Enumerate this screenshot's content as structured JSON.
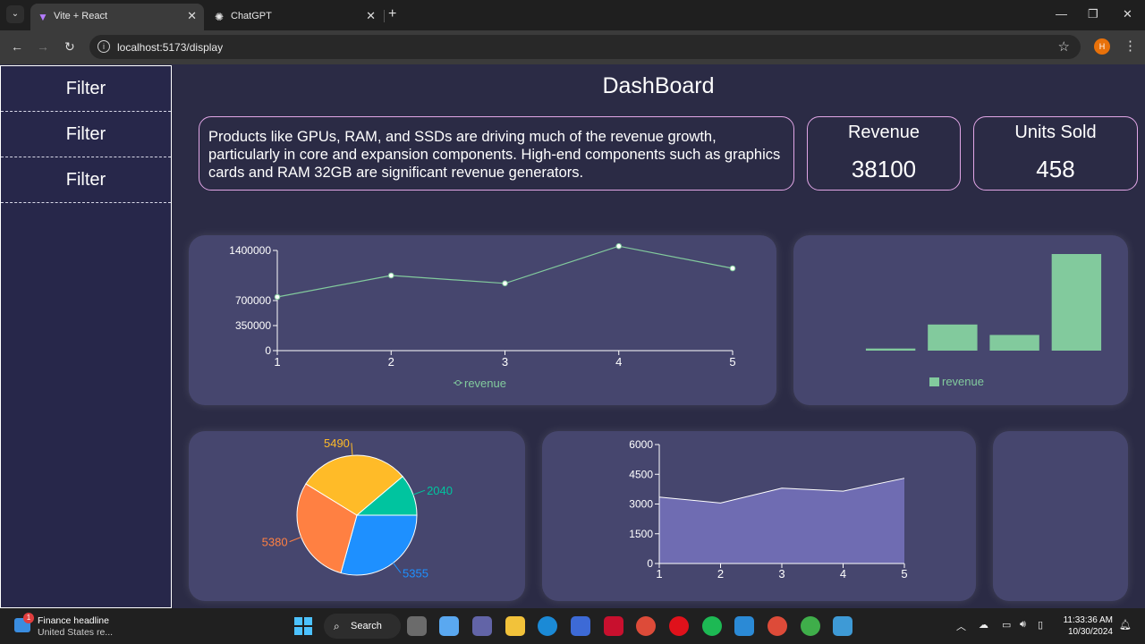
{
  "browser": {
    "tabs": [
      {
        "title": "Vite + React",
        "icon": "vite-icon",
        "active": true
      },
      {
        "title": "ChatGPT",
        "icon": "chatgpt-icon",
        "active": false
      }
    ],
    "url": "localhost:5173/display",
    "profile_initial": "H"
  },
  "sidebar": {
    "items": [
      {
        "label": "Filter"
      },
      {
        "label": "Filter"
      },
      {
        "label": "Filter"
      }
    ]
  },
  "dashboard": {
    "title": "DashBoard",
    "insight": "Products like GPUs, RAM, and SSDs are driving much of the revenue growth, particularly in core and expansion components. High-end components such as graphics cards and RAM 32GB are significant revenue generators.",
    "stats": [
      {
        "label": "Revenue",
        "value": "38100"
      },
      {
        "label": "Units Sold",
        "value": "458"
      }
    ]
  },
  "colors": {
    "page_bg": "#2b2b45",
    "card_bg": "#46466e",
    "line_green": "#82ca9d",
    "area_purple": "#6f6cb2",
    "card_border": "#e1a6e6",
    "pie": [
      "#1e90ff",
      "#ff8042",
      "#ffbb28",
      "#00c49f"
    ]
  },
  "chart_data": [
    {
      "type": "line",
      "x": [
        1,
        2,
        3,
        4,
        5
      ],
      "series": [
        {
          "name": "revenue",
          "values": [
            750000,
            1050000,
            940000,
            1460000,
            1150000
          ]
        }
      ],
      "yticks": [
        "0",
        "350000",
        "700000",
        "1400000"
      ],
      "ylim": [
        0,
        1400000
      ],
      "legend": "bottom",
      "grid": false
    },
    {
      "type": "bar",
      "categories": [
        "1",
        "2",
        "3",
        "4"
      ],
      "series": [
        {
          "name": "revenue",
          "values": [
            40000,
            500000,
            300000,
            1850000
          ]
        }
      ],
      "ylim": [
        0,
        1850000
      ],
      "axes_visible": false,
      "legend": "bottom"
    },
    {
      "type": "pie",
      "slices": [
        {
          "value": 5355,
          "color": "#1e90ff"
        },
        {
          "value": 5380,
          "color": "#ff8042"
        },
        {
          "value": 5490,
          "color": "#ffbb28"
        },
        {
          "value": 2040,
          "color": "#00c49f"
        }
      ],
      "labels": [
        "5355",
        "5380",
        "5490",
        "2040"
      ]
    },
    {
      "type": "area",
      "x": [
        1,
        2,
        3,
        4,
        5
      ],
      "series": [
        {
          "values": [
            3350,
            3050,
            3800,
            3650,
            4300
          ]
        }
      ],
      "yticks": [
        "0",
        "1500",
        "3000",
        "4500",
        "6000"
      ],
      "ylim": [
        0,
        6000
      ],
      "grid": false
    }
  ],
  "taskbar": {
    "news_title": "Finance headline",
    "news_sub": "United States re...",
    "news_badge": "1",
    "search_label": "Search",
    "time": "11:33:36 AM",
    "date": "10/30/2024"
  }
}
